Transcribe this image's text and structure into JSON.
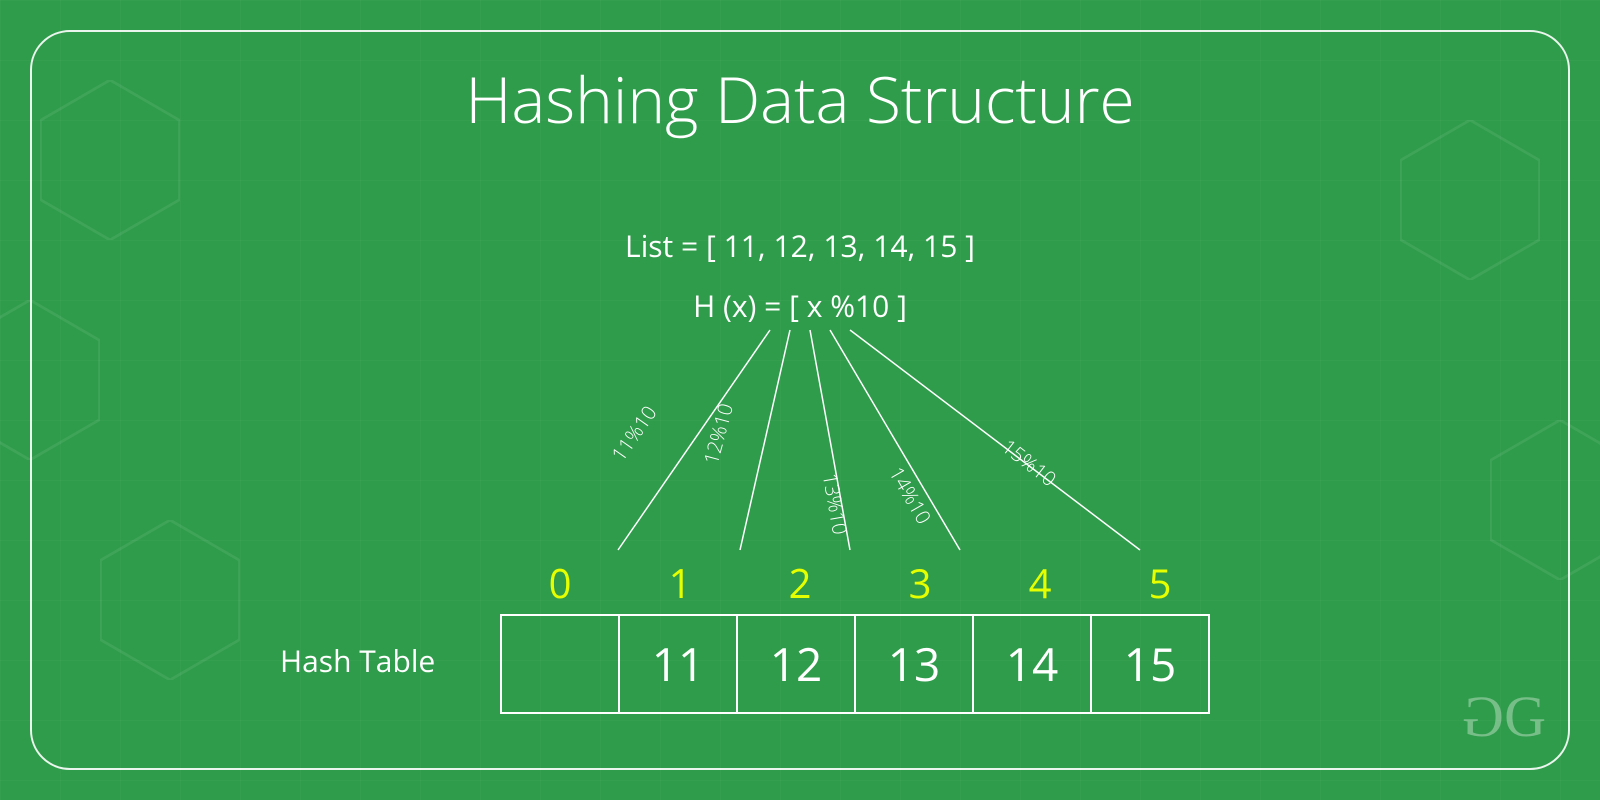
{
  "title": "Hashing Data Structure",
  "list_line": "List = [ 11, 12, 13, 14, 15 ]",
  "function_line": "H (x) = [ x %10 ]",
  "arrows": [
    {
      "label": "11%10"
    },
    {
      "label": "12%10"
    },
    {
      "label": "13%10"
    },
    {
      "label": "14%10"
    },
    {
      "label": "15%10"
    }
  ],
  "indices": [
    "0",
    "1",
    "2",
    "3",
    "4",
    "5"
  ],
  "cells": [
    "",
    "11",
    "12",
    "13",
    "14",
    "15"
  ],
  "table_label": "Hash Table",
  "logo": "GG",
  "colors": {
    "bg": "#2e9c4a",
    "text": "#ffffff",
    "index": "#e6ff00"
  }
}
